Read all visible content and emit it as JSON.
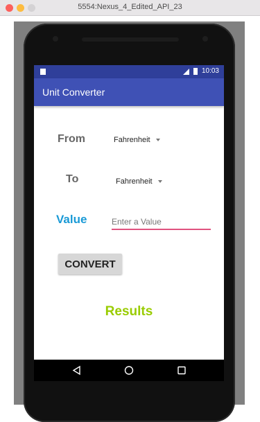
{
  "window": {
    "title": "5554:Nexus_4_Edited_API_23"
  },
  "statusbar": {
    "time": "10:03"
  },
  "app": {
    "title": "Unit Converter",
    "from_label": "From",
    "from_value": "Fahrenheit",
    "to_label": "To",
    "to_value": "Fahrenheit",
    "value_label": "Value",
    "value_placeholder": "Enter a Value",
    "value_text": "",
    "convert_label": "CONVERT",
    "results_label": "Results"
  },
  "colors": {
    "appbar": "#3f51b5",
    "statusbar": "#2f3f9a",
    "value_label": "#1a9ad6",
    "input_underline": "#e0527e",
    "results": "#99cc00"
  },
  "navbar": {
    "icons": [
      "back-icon",
      "home-icon",
      "recents-icon"
    ]
  }
}
